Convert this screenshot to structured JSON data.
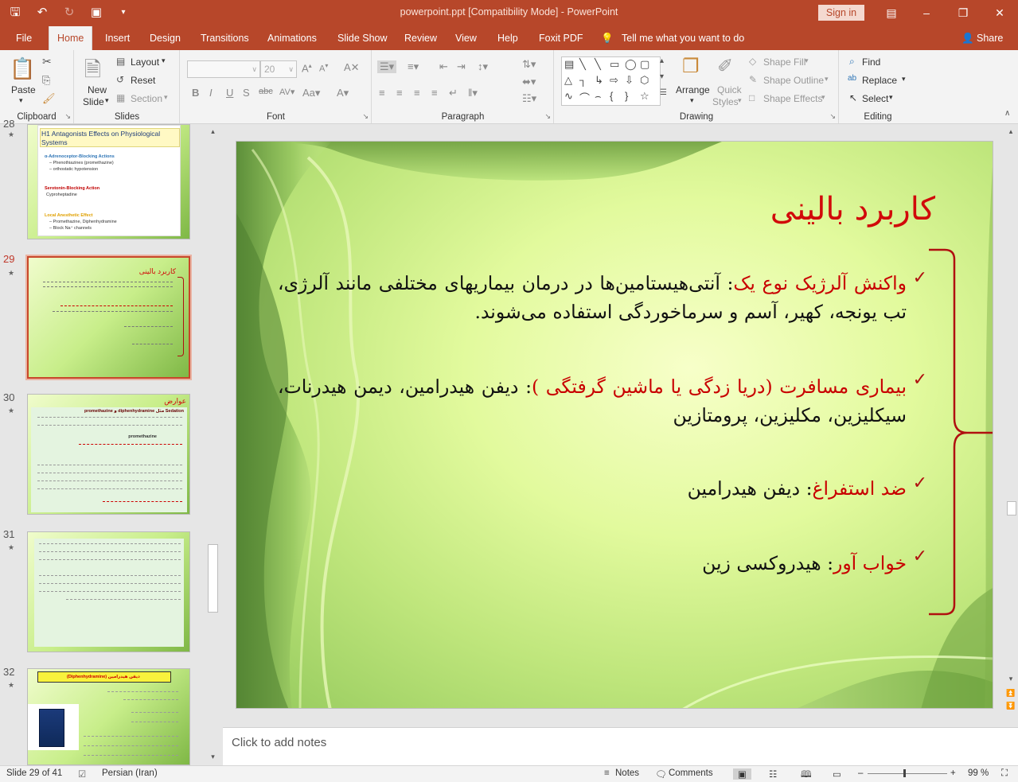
{
  "window": {
    "title": "powerpoint.ppt [Compatibility Mode]  -  PowerPoint",
    "sign_in": "Sign in"
  },
  "tabs": [
    "File",
    "Home",
    "Insert",
    "Design",
    "Transitions",
    "Animations",
    "Slide Show",
    "Review",
    "View",
    "Help",
    "Foxit PDF"
  ],
  "tell_me": "Tell me what you want to do",
  "share": "Share",
  "ribbon": {
    "clipboard": {
      "name": "Clipboard",
      "paste": "Paste"
    },
    "slides": {
      "name": "Slides",
      "new_slide_1": "New",
      "new_slide_2": "Slide",
      "layout": "Layout",
      "reset": "Reset",
      "section": "Section"
    },
    "font": {
      "name": "Font",
      "size": "20"
    },
    "paragraph": {
      "name": "Paragraph"
    },
    "drawing": {
      "name": "Drawing",
      "arrange": "Arrange",
      "quick_styles_1": "Quick",
      "quick_styles_2": "Styles",
      "shape_fill": "Shape Fill",
      "shape_outline": "Shape Outline",
      "shape_effects": "Shape Effects"
    },
    "editing": {
      "name": "Editing",
      "find": "Find",
      "replace": "Replace",
      "select": "Select"
    }
  },
  "thumbnails": {
    "prev_num_partial": "28",
    "t28_title": "H1 Antagonists Effects on Physiological Systems",
    "t28_l1": "α-Adrenoceptor-Blocking Actions",
    "t28_l2": "– Phenothiazines (promethazine)",
    "t28_l3": "– orthostatic hypotension",
    "t28_l4": "Serotonin-Blocking Action",
    "t28_l5": "Cyproheptadine",
    "t28_l6": "Local Anesthetic Effect",
    "t28_l7": "– Promethazine, Diphenhydramine",
    "t28_l8": "– Block Na⁺ channels",
    "n29": "29",
    "t29_title": "کاربرد بالینی",
    "n30": "30",
    "t30_title": "عوارض",
    "t30_l1": "promethazine و diphenhydramine مثل Sedation",
    "t30_l2": "promethazine",
    "n31": "31",
    "n32": "32",
    "t32_title": "(Diphenhydramine) دیفن هیدرامین"
  },
  "slide": {
    "title": "کاربرد بالینی",
    "b1_red": "واکنش آلرژیک نوع یک",
    "b1_rest": ": آنتی‌هیستامین‌ها در درمان بیماریهای مختلفی مانند آلرژی، تب یونجه، کهیر، آسم و سرماخوردگی استفاده می‌شوند.",
    "b2_red": "بیماری مسافرت (دریا زدگی یا ماشین گرفتگی )",
    "b2_rest": ": دیفن هیدرامین، دیمن هیدرنات، سیکلیزین، مکلیزین، پرومتازین",
    "b3_red": "ضد استفراغ",
    "b3_rest": ": دیفن هیدرامین",
    "b4_red": "خواب آور",
    "b4_rest": ": هیدروکسی زین"
  },
  "notes_placeholder": "Click to add notes",
  "status": {
    "slide_info": "Slide 29 of 41",
    "language": "Persian (Iran)",
    "notes": "Notes",
    "comments": "Comments",
    "zoom": "99 %"
  },
  "colors": {
    "accent": "#b7472a",
    "title_red": "#d10a0a",
    "brace_red": "#b01010"
  }
}
